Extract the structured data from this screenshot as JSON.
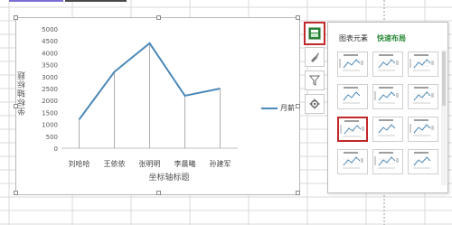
{
  "chart": {
    "ylabel": "坐标轴标题",
    "xlabel": "坐标轴标题",
    "legend": "月薪"
  },
  "chart_data": {
    "type": "line",
    "categories": [
      "刘哈哈",
      "王依依",
      "张明明",
      "李晨曦",
      "孙建军"
    ],
    "series": [
      {
        "name": "月薪",
        "values": [
          1200,
          3200,
          4400,
          2200,
          2500
        ]
      }
    ],
    "y_ticks": [
      "5000",
      "4500",
      "4000",
      "3500",
      "3000",
      "2500",
      "2000",
      "1500",
      "1000",
      "500",
      "0"
    ],
    "ylim": [
      0,
      5000
    ],
    "xlabel": "坐标轴标题",
    "ylabel": "坐标轴标题",
    "legend_position": "right",
    "series_color": "#4a88b8"
  },
  "side_buttons": [
    "chart-elements",
    "chart-styles",
    "chart-filters",
    "settings"
  ],
  "panel": {
    "tab_elements": "图表元素",
    "tab_quick_layout": "快速布局",
    "layouts_count": 12,
    "selected_layout": 7
  },
  "colors": {
    "accent": "#c0282a",
    "tab_active": "#2e8b3b",
    "line": "#4a88b8"
  }
}
